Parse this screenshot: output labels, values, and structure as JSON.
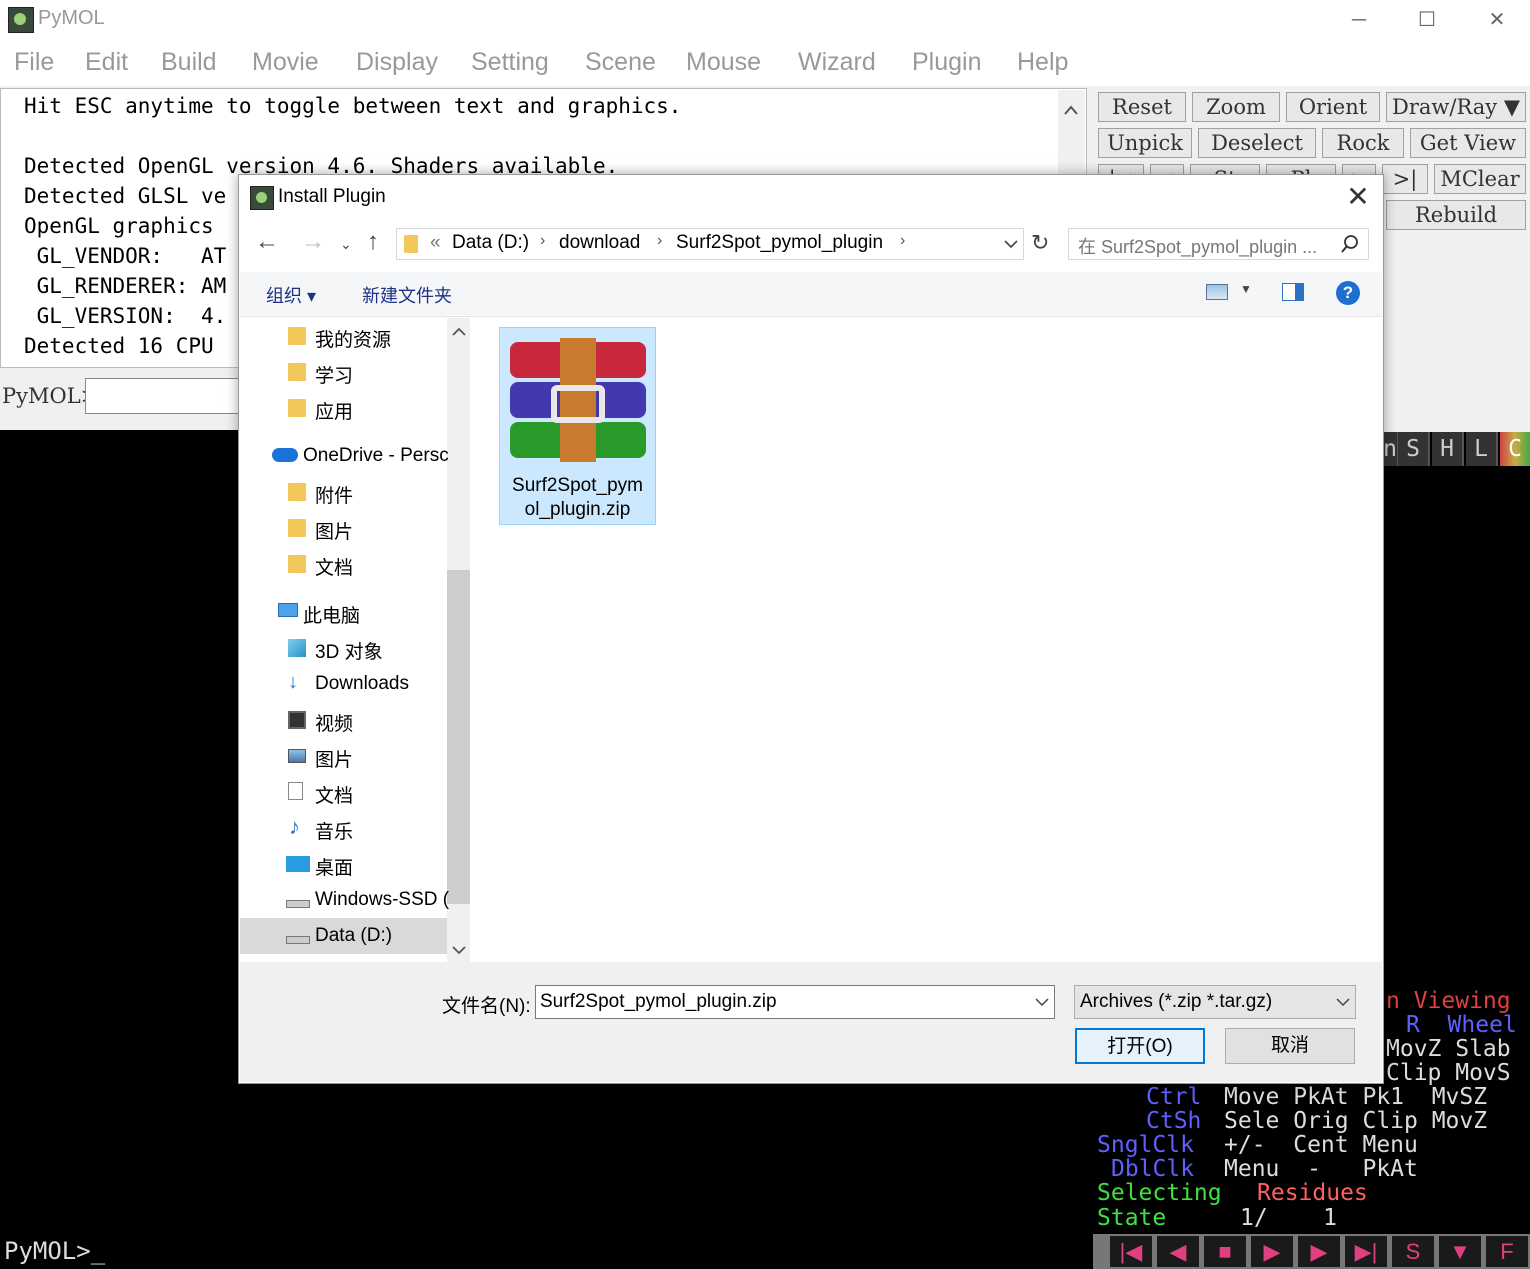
{
  "window": {
    "title": "PyMOL",
    "minimize": "─",
    "maximize": "☐",
    "close": "✕"
  },
  "menubar": [
    "File",
    "Edit",
    "Build",
    "Movie",
    "Display",
    "Setting",
    "Scene",
    "Mouse",
    "Wizard",
    "Plugin",
    "Help"
  ],
  "output_lines": [
    "Hit ESC anytime to toggle between text and graphics.",
    "",
    "Detected OpenGL version 4.6. Shaders available.",
    "Detected GLSL ve",
    "OpenGL graphics ",
    " GL_VENDOR:   AT",
    " GL_RENDERER: AM",
    " GL_VERSION:  4.",
    "Detected 16 CPU "
  ],
  "command": {
    "label": "PyMOL>",
    "bottom_prompt": "PyMOL>_"
  },
  "control_buttons": {
    "row1": [
      "Reset",
      "Zoom",
      "Orient",
      "Draw/Ray ▼"
    ],
    "row2": [
      "Unpick",
      "Deselect",
      "Rock",
      "Get View"
    ],
    "row3": [
      "|<",
      "<",
      "St",
      "Pl",
      ">",
      ">|",
      "MClear"
    ],
    "row4": [
      "Rebuild"
    ]
  },
  "object_panel": {
    "shlc": [
      "n",
      "S",
      "H",
      "L",
      "C"
    ]
  },
  "mouse_panel": {
    "line1": "n Viewing",
    "line2": "R  Wheel",
    "line3": "MovZ Slab",
    "line4": "Clip MovS",
    "line5_label": "Ctrl",
    "line5_vals": "Move PkAt Pk1  MvSZ",
    "line6_label": "CtSh",
    "line6_vals": "Sele Orig Clip MovZ",
    "line7_label": "SnglClk",
    "line7_vals": "+/-  Cent Menu",
    "line8_label": "DblClk",
    "line8_vals": "Menu  -   PkAt",
    "selecting_label": "Selecting",
    "selecting_value": "Residues",
    "state_label": "State",
    "state_value": "1/    1"
  },
  "movie_controls": [
    "|◀",
    "◀",
    "■",
    "▶",
    "▶",
    "▶|",
    "S",
    "▼",
    "F"
  ],
  "dialog": {
    "title": "Install Plugin",
    "close": "✕",
    "breadcrumb": [
      "«",
      "Data (D:)",
      "download",
      "Surf2Spot_pymol_plugin"
    ],
    "search_placeholder": "在 Surf2Spot_pymol_plugin ...",
    "organize": "组织 ▾",
    "new_folder": "新建文件夹",
    "help_icon": "?",
    "nav_items": [
      {
        "label": "我的资源",
        "icon": "folder-icon"
      },
      {
        "label": "学习",
        "icon": "folder-icon"
      },
      {
        "label": "应用",
        "icon": "folder-icon"
      },
      {
        "label": "OneDrive - Persc",
        "icon": "cloud-icon"
      },
      {
        "label": "附件",
        "icon": "folder-icon"
      },
      {
        "label": "图片",
        "icon": "folder-icon"
      },
      {
        "label": "文档",
        "icon": "folder-icon"
      },
      {
        "label": "此电脑",
        "icon": "computer-icon"
      },
      {
        "label": "3D 对象",
        "icon": "cube-icon"
      },
      {
        "label": "Downloads",
        "icon": "download-icon"
      },
      {
        "label": "视频",
        "icon": "video-icon"
      },
      {
        "label": "图片",
        "icon": "picture-icon"
      },
      {
        "label": "文档",
        "icon": "document-icon"
      },
      {
        "label": "音乐",
        "icon": "music-icon"
      },
      {
        "label": "桌面",
        "icon": "desktop-icon"
      },
      {
        "label": "Windows-SSD (",
        "icon": "drive-icon"
      },
      {
        "label": "Data (D:)",
        "icon": "drive-icon"
      }
    ],
    "file_name_line1": "Surf2Spot_pym",
    "file_name_line2": "ol_plugin.zip",
    "filename_label": "文件名(N):",
    "filename_value": "Surf2Spot_pymol_plugin.zip",
    "filetype_value": "Archives (*.zip *.tar.gz)",
    "open_button": "打开(O)",
    "cancel_button": "取消"
  }
}
